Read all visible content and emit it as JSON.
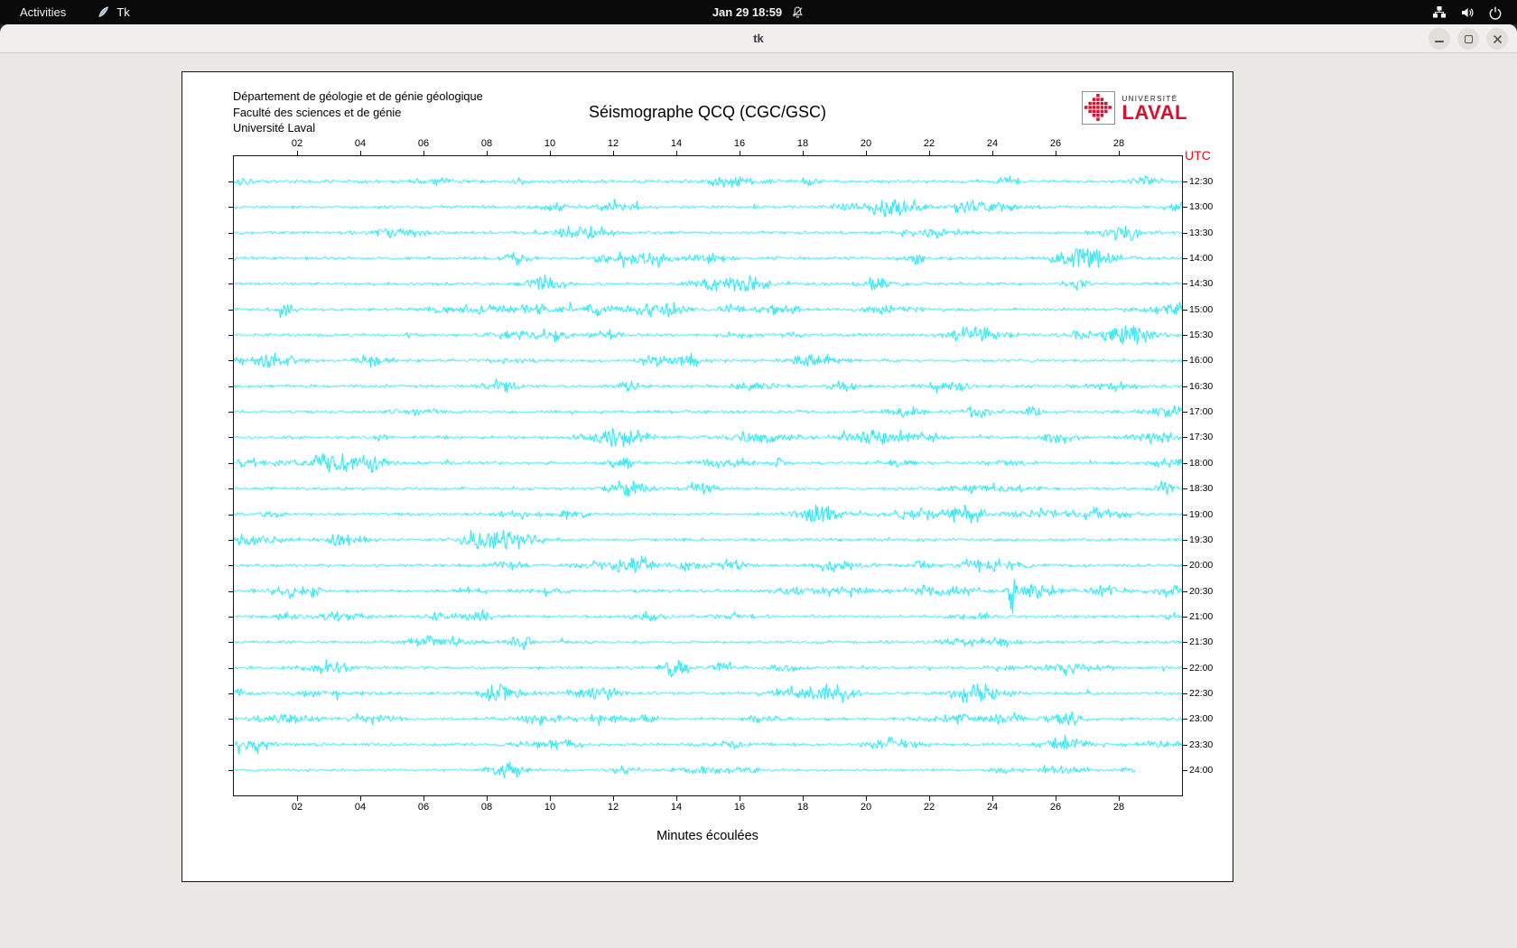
{
  "topbar": {
    "activities_label": "Activities",
    "app_indicator": "Tk",
    "clock": "Jan 29 18:59"
  },
  "titlebar": {
    "title": "tk"
  },
  "seismograph": {
    "institution_lines": [
      "Département de géologie et de génie géologique",
      "Faculté des sciences et de génie",
      "Université Laval"
    ],
    "title": "Séismographe QCQ (CGC/GSC)",
    "utc_label": "UTC",
    "xlabel": "Minutes écoulées",
    "x_tick_labels": [
      "02",
      "04",
      "06",
      "08",
      "10",
      "12",
      "14",
      "16",
      "18",
      "20",
      "22",
      "24",
      "26",
      "28"
    ],
    "x_minutes_total": 30,
    "row_labels": [
      "12:30",
      "13:00",
      "13:30",
      "14:00",
      "14:30",
      "15:00",
      "15:30",
      "16:00",
      "16:30",
      "17:00",
      "17:30",
      "18:00",
      "18:30",
      "19:00",
      "19:30",
      "20:00",
      "20:30",
      "21:00",
      "21:30",
      "22:00",
      "22:30",
      "23:00",
      "23:30",
      "24:00"
    ],
    "trace_color": "#00dfec",
    "notable_event": {
      "row_label": "20:30",
      "minute": 24.6
    },
    "last_row_end_minute": 28.5,
    "logo": {
      "top": "UNIVERSITÉ",
      "bottom": "LAVAL",
      "red": "#d8102e"
    }
  }
}
